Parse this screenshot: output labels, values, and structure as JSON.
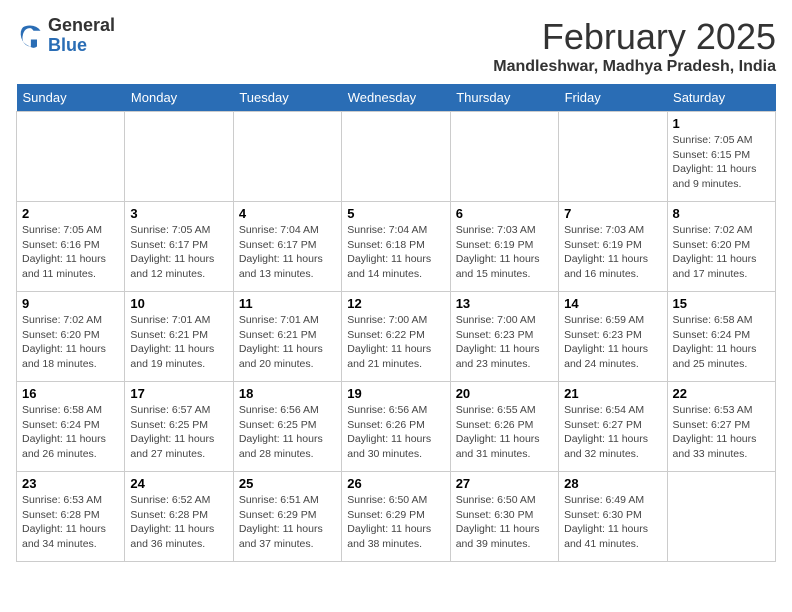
{
  "header": {
    "logo_general": "General",
    "logo_blue": "Blue",
    "month_title": "February 2025",
    "location": "Mandleshwar, Madhya Pradesh, India"
  },
  "weekdays": [
    "Sunday",
    "Monday",
    "Tuesday",
    "Wednesday",
    "Thursday",
    "Friday",
    "Saturday"
  ],
  "weeks": [
    [
      {
        "day": "",
        "info": ""
      },
      {
        "day": "",
        "info": ""
      },
      {
        "day": "",
        "info": ""
      },
      {
        "day": "",
        "info": ""
      },
      {
        "day": "",
        "info": ""
      },
      {
        "day": "",
        "info": ""
      },
      {
        "day": "1",
        "info": "Sunrise: 7:05 AM\nSunset: 6:15 PM\nDaylight: 11 hours and 9 minutes."
      }
    ],
    [
      {
        "day": "2",
        "info": "Sunrise: 7:05 AM\nSunset: 6:16 PM\nDaylight: 11 hours and 11 minutes."
      },
      {
        "day": "3",
        "info": "Sunrise: 7:05 AM\nSunset: 6:17 PM\nDaylight: 11 hours and 12 minutes."
      },
      {
        "day": "4",
        "info": "Sunrise: 7:04 AM\nSunset: 6:17 PM\nDaylight: 11 hours and 13 minutes."
      },
      {
        "day": "5",
        "info": "Sunrise: 7:04 AM\nSunset: 6:18 PM\nDaylight: 11 hours and 14 minutes."
      },
      {
        "day": "6",
        "info": "Sunrise: 7:03 AM\nSunset: 6:19 PM\nDaylight: 11 hours and 15 minutes."
      },
      {
        "day": "7",
        "info": "Sunrise: 7:03 AM\nSunset: 6:19 PM\nDaylight: 11 hours and 16 minutes."
      },
      {
        "day": "8",
        "info": "Sunrise: 7:02 AM\nSunset: 6:20 PM\nDaylight: 11 hours and 17 minutes."
      }
    ],
    [
      {
        "day": "9",
        "info": "Sunrise: 7:02 AM\nSunset: 6:20 PM\nDaylight: 11 hours and 18 minutes."
      },
      {
        "day": "10",
        "info": "Sunrise: 7:01 AM\nSunset: 6:21 PM\nDaylight: 11 hours and 19 minutes."
      },
      {
        "day": "11",
        "info": "Sunrise: 7:01 AM\nSunset: 6:21 PM\nDaylight: 11 hours and 20 minutes."
      },
      {
        "day": "12",
        "info": "Sunrise: 7:00 AM\nSunset: 6:22 PM\nDaylight: 11 hours and 21 minutes."
      },
      {
        "day": "13",
        "info": "Sunrise: 7:00 AM\nSunset: 6:23 PM\nDaylight: 11 hours and 23 minutes."
      },
      {
        "day": "14",
        "info": "Sunrise: 6:59 AM\nSunset: 6:23 PM\nDaylight: 11 hours and 24 minutes."
      },
      {
        "day": "15",
        "info": "Sunrise: 6:58 AM\nSunset: 6:24 PM\nDaylight: 11 hours and 25 minutes."
      }
    ],
    [
      {
        "day": "16",
        "info": "Sunrise: 6:58 AM\nSunset: 6:24 PM\nDaylight: 11 hours and 26 minutes."
      },
      {
        "day": "17",
        "info": "Sunrise: 6:57 AM\nSunset: 6:25 PM\nDaylight: 11 hours and 27 minutes."
      },
      {
        "day": "18",
        "info": "Sunrise: 6:56 AM\nSunset: 6:25 PM\nDaylight: 11 hours and 28 minutes."
      },
      {
        "day": "19",
        "info": "Sunrise: 6:56 AM\nSunset: 6:26 PM\nDaylight: 11 hours and 30 minutes."
      },
      {
        "day": "20",
        "info": "Sunrise: 6:55 AM\nSunset: 6:26 PM\nDaylight: 11 hours and 31 minutes."
      },
      {
        "day": "21",
        "info": "Sunrise: 6:54 AM\nSunset: 6:27 PM\nDaylight: 11 hours and 32 minutes."
      },
      {
        "day": "22",
        "info": "Sunrise: 6:53 AM\nSunset: 6:27 PM\nDaylight: 11 hours and 33 minutes."
      }
    ],
    [
      {
        "day": "23",
        "info": "Sunrise: 6:53 AM\nSunset: 6:28 PM\nDaylight: 11 hours and 34 minutes."
      },
      {
        "day": "24",
        "info": "Sunrise: 6:52 AM\nSunset: 6:28 PM\nDaylight: 11 hours and 36 minutes."
      },
      {
        "day": "25",
        "info": "Sunrise: 6:51 AM\nSunset: 6:29 PM\nDaylight: 11 hours and 37 minutes."
      },
      {
        "day": "26",
        "info": "Sunrise: 6:50 AM\nSunset: 6:29 PM\nDaylight: 11 hours and 38 minutes."
      },
      {
        "day": "27",
        "info": "Sunrise: 6:50 AM\nSunset: 6:30 PM\nDaylight: 11 hours and 39 minutes."
      },
      {
        "day": "28",
        "info": "Sunrise: 6:49 AM\nSunset: 6:30 PM\nDaylight: 11 hours and 41 minutes."
      },
      {
        "day": "",
        "info": ""
      }
    ]
  ]
}
